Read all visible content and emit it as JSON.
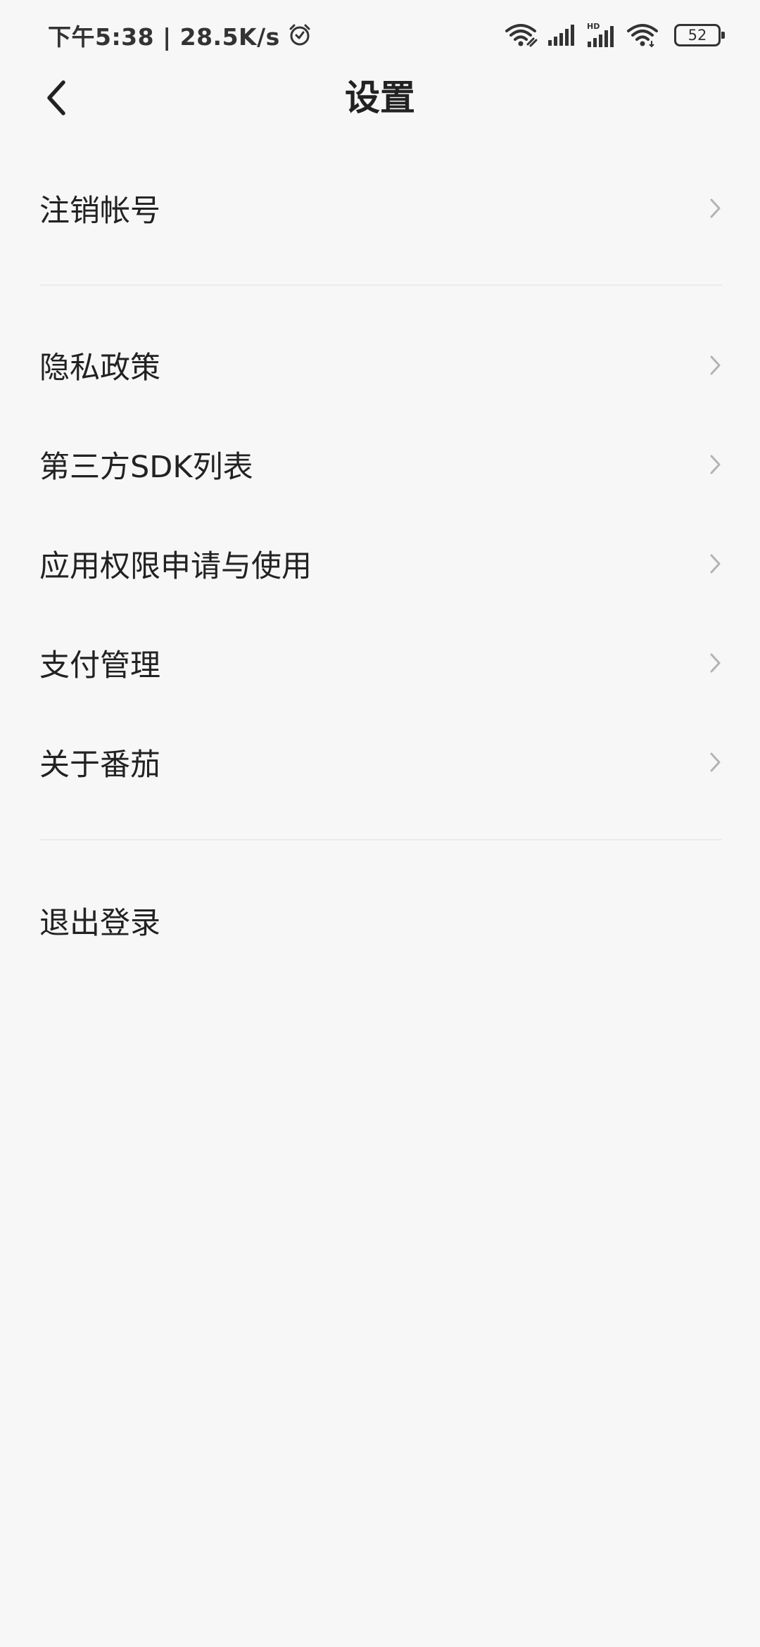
{
  "status_bar": {
    "time_speed": "下午5:38 | 28.5K/s",
    "battery_level": "52",
    "icons": [
      "alarm-icon",
      "wifi-link-icon",
      "signal-icon",
      "hd-signal-icon",
      "wifi-icon",
      "battery-icon"
    ]
  },
  "header": {
    "title": "设置",
    "back_icon": "chevron-left-icon"
  },
  "settings": {
    "group1": [
      {
        "label": "注销帐号"
      }
    ],
    "group2": [
      {
        "label": "隐私政策"
      },
      {
        "label": "第三方SDK列表"
      },
      {
        "label": "应用权限申请与使用"
      },
      {
        "label": "支付管理"
      },
      {
        "label": "关于番茄"
      }
    ],
    "group3": [
      {
        "label": "退出登录"
      }
    ]
  },
  "colors": {
    "background": "#f7f7f7",
    "text": "#222222",
    "chevron": "#b3b3b3",
    "divider": "#ebebeb"
  }
}
